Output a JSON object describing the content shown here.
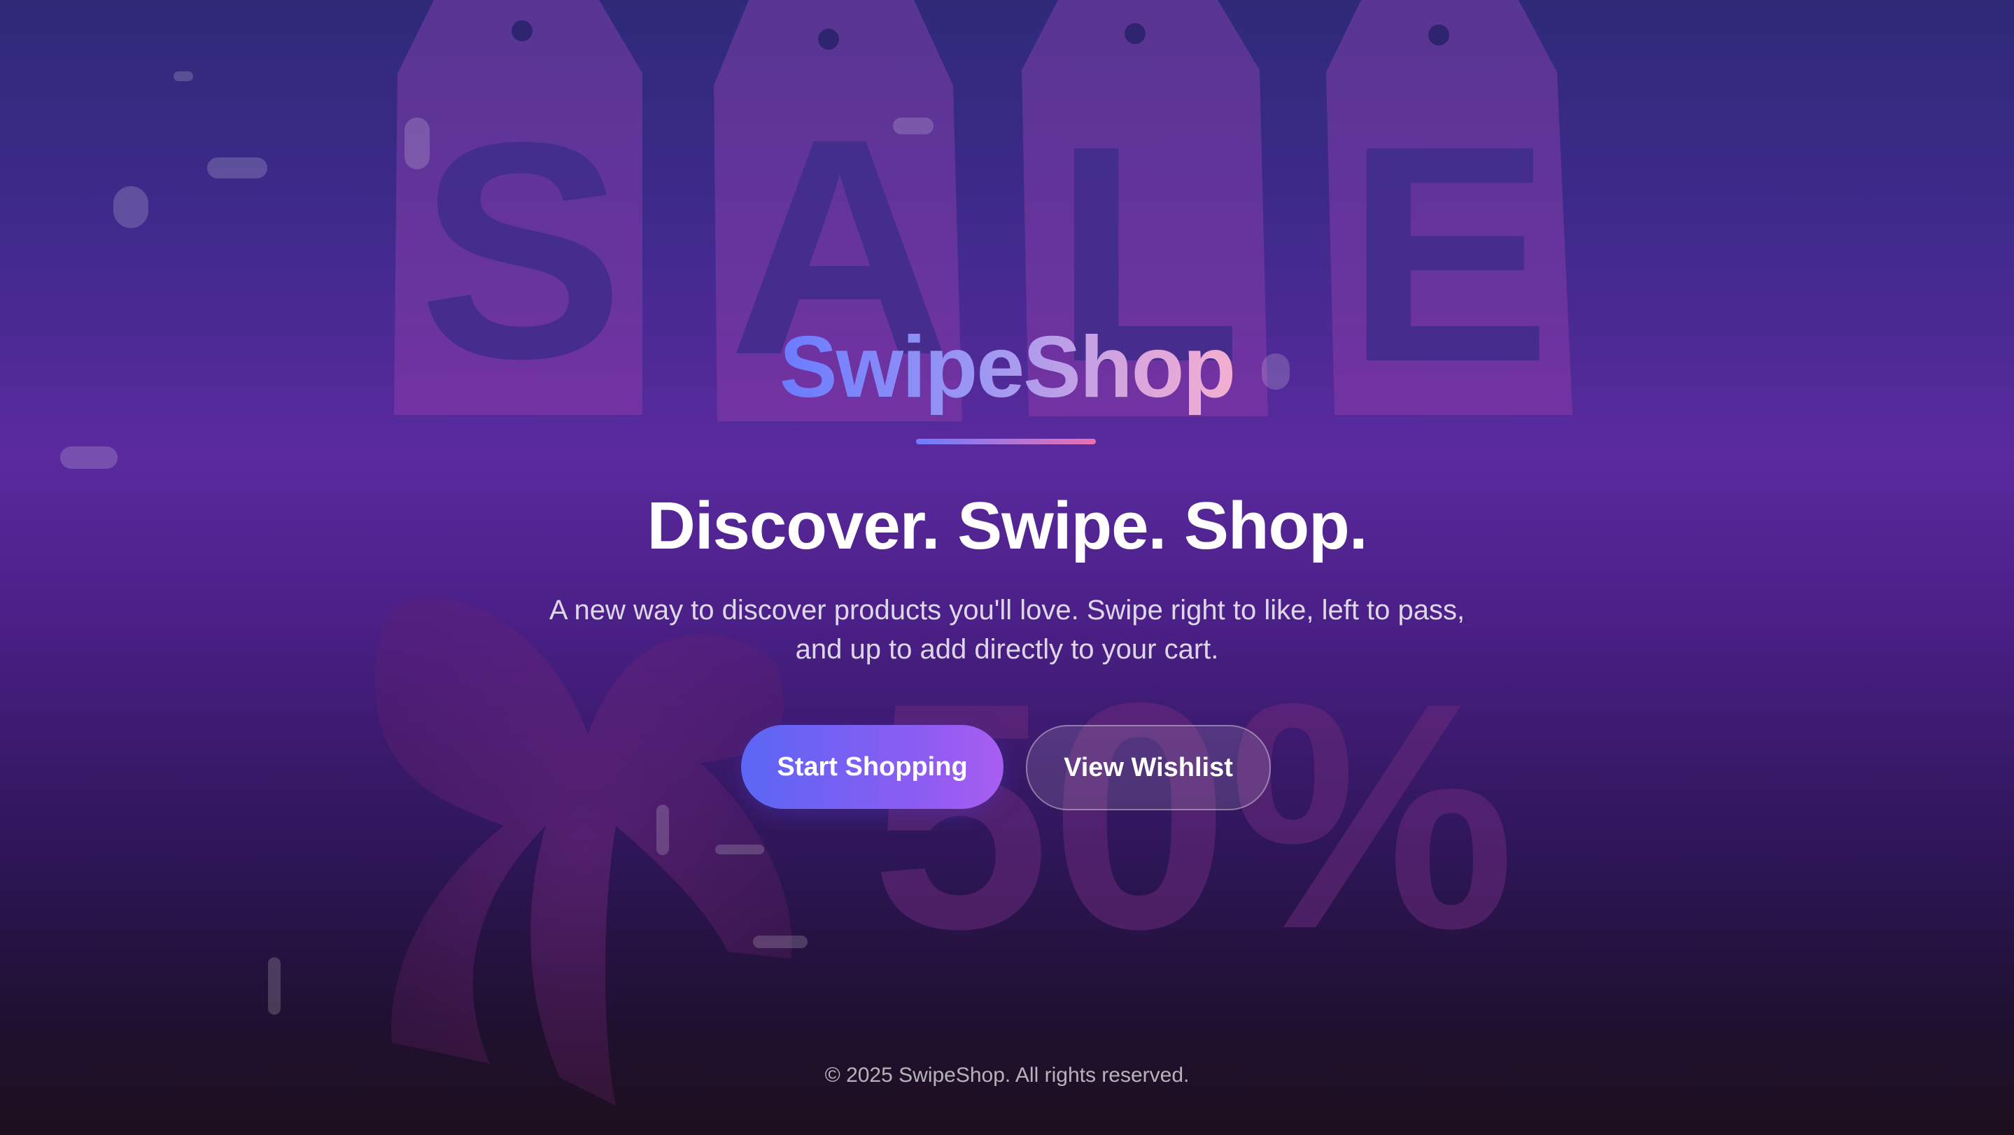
{
  "brand": {
    "name": "SwipeShop"
  },
  "hero": {
    "headline": "Discover. Swipe. Shop.",
    "description_line1": "A new way to discover products you'll love. Swipe right to like, left to pass,",
    "description_line2": "and up to add directly to your cart.",
    "primary_button": "Start Shopping",
    "secondary_button": "View Wishlist"
  },
  "background": {
    "tag_letters": [
      "S",
      "A",
      "L",
      "E"
    ],
    "discount_text": "50%"
  },
  "footer": {
    "copyright": "© 2025 SwipeShop. All rights reserved."
  },
  "colors": {
    "accent_start": "#5b66f5",
    "accent_end": "#a95ef0",
    "divider_end": "#ec6fb3"
  }
}
